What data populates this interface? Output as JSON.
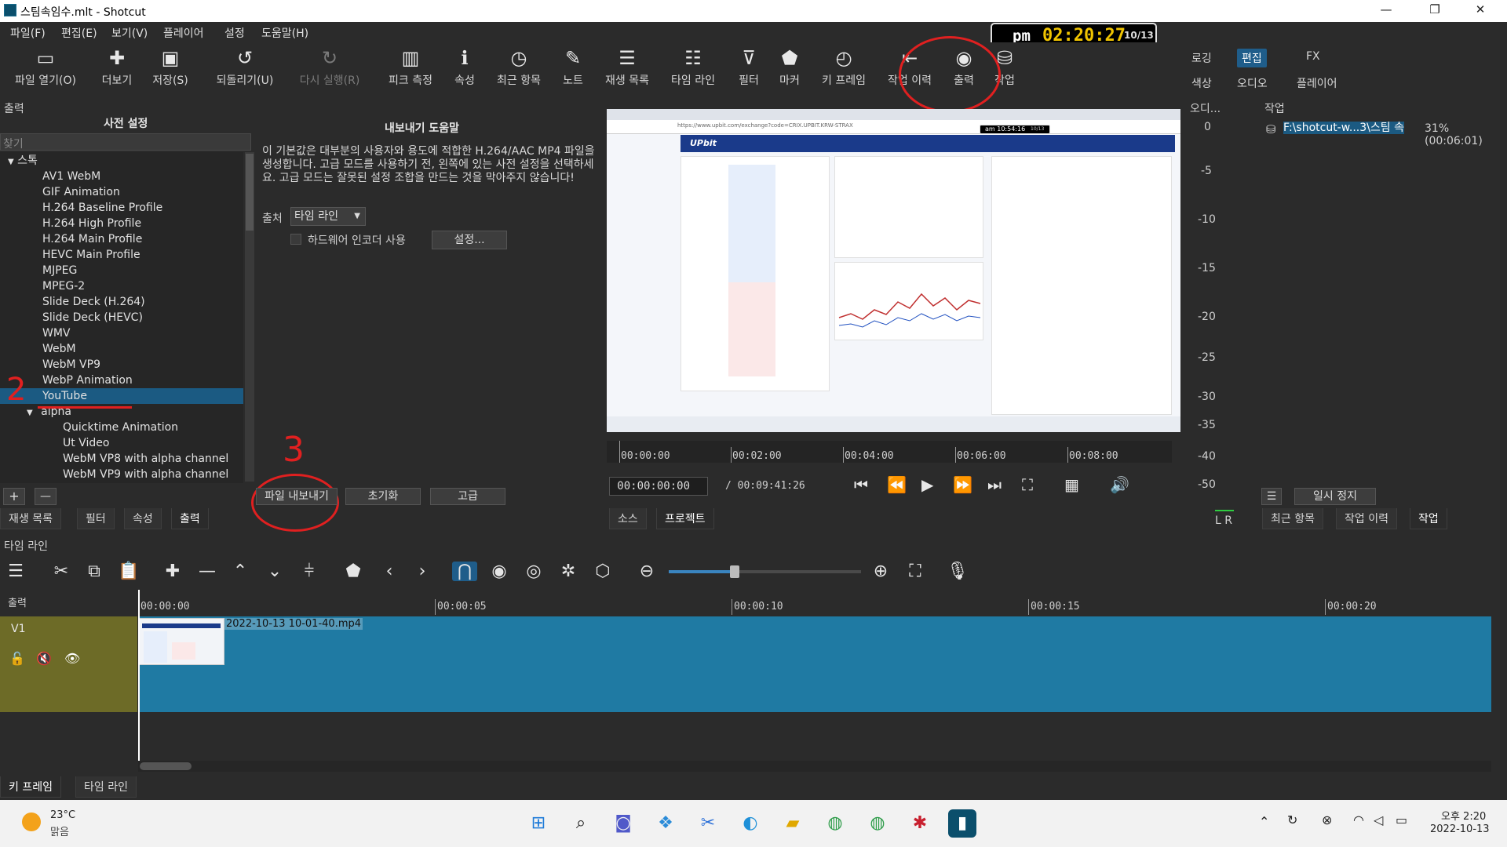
{
  "window": {
    "title": "스팀속임수.mlt - Shotcut",
    "min": "—",
    "max": "❐",
    "close": "✕"
  },
  "menu": [
    "파일(F)",
    "편집(E)",
    "보기(V)",
    "플레이어",
    "설정",
    "도움말(H)"
  ],
  "toolbar": [
    {
      "label": "파일 열기(O)",
      "icon": "folder-open-icon",
      "glyph": "▭"
    },
    {
      "label": "더보기",
      "icon": "more-icon",
      "glyph": "✚"
    },
    {
      "label": "저장(S)",
      "icon": "save-icon",
      "glyph": "▣"
    },
    {
      "label": "되돌리기(U)",
      "icon": "undo-icon",
      "glyph": "↺"
    },
    {
      "label": "다시 실행(R)",
      "icon": "redo-icon",
      "glyph": "↻"
    },
    {
      "label": "피크 측정",
      "icon": "peak-meter-icon",
      "glyph": "▥"
    },
    {
      "label": "속성",
      "icon": "properties-icon",
      "glyph": "ℹ"
    },
    {
      "label": "최근 항목",
      "icon": "recent-icon",
      "glyph": "◷"
    },
    {
      "label": "노트",
      "icon": "notes-icon",
      "glyph": "✎"
    },
    {
      "label": "재생 목록",
      "icon": "playlist-icon",
      "glyph": "☰"
    },
    {
      "label": "타임 라인",
      "icon": "timeline-icon",
      "glyph": "☷"
    },
    {
      "label": "필터",
      "icon": "filter-icon",
      "glyph": "⊽"
    },
    {
      "label": "마커",
      "icon": "marker-icon",
      "glyph": "⬟"
    },
    {
      "label": "키 프레임",
      "icon": "keyframe-icon",
      "glyph": "◴"
    },
    {
      "label": "작업 이력",
      "icon": "history-icon",
      "glyph": "⇤"
    },
    {
      "label": "출력",
      "icon": "export-icon",
      "glyph": "◉"
    },
    {
      "label": "작업",
      "icon": "jobs-icon",
      "glyph": "⛁"
    }
  ],
  "modes": {
    "logging": "로깅",
    "editing": "편집",
    "fx": "FX",
    "color": "색상",
    "audio": "오디오",
    "player": "플레이어"
  },
  "clock": {
    "ampm": "pm",
    "time": "02:20:27",
    "date": "10/13"
  },
  "export_panel": {
    "panel_title": "출력",
    "presets_header": "사전 설정",
    "search_placeholder": "찾기",
    "stock_group": "스톡",
    "presets": [
      "AV1 WebM",
      "GIF Animation",
      "H.264 Baseline Profile",
      "H.264 High Profile",
      "H.264 Main Profile",
      "HEVC Main Profile",
      "MJPEG",
      "MPEG-2",
      "Slide Deck (H.264)",
      "Slide Deck (HEVC)",
      "WMV",
      "WebM",
      "WebM VP9",
      "WebP Animation",
      "YouTube"
    ],
    "selected_preset": "YouTube",
    "alpha_group": "alpha",
    "alpha_presets": [
      "Quicktime Animation",
      "Ut Video",
      "WebM VP8 with alpha channel",
      "WebM VP9 with alpha channel"
    ],
    "help_title": "내보내기 도움말",
    "help_text": "이 기본값은 대부분의 사용자와 용도에 적합한 H.264/AAC MP4 파일을 생성합니다. 고급 모드를 사용하기 전, 왼쪽에 있는 사전 설정을 선택하세요. 고급 모드는 잘못된 설정 조합을 만드는 것을 막아주지 않습니다!",
    "source_label": "출처",
    "source_value": "타임 라인",
    "hw_encoder_label": "하드웨어 인코더 사용",
    "settings_button": "설정...",
    "export_file_button": "파일 내보내기",
    "reset_button": "초기화",
    "advanced_button": "고급",
    "add_button": "+",
    "remove_button": "—"
  },
  "left_tabs": [
    "재생 목록",
    "필터",
    "속성",
    "출력"
  ],
  "player": {
    "ruler": [
      "00:00:00",
      "00:02:00",
      "00:04:00",
      "00:06:00",
      "00:08:00"
    ],
    "position": "00:00:00:00",
    "duration": "/ 00:09:41:26",
    "tabs": [
      "소스",
      "프로젝트"
    ],
    "embedded": {
      "brand": "UPbit",
      "clock": "am 10:54:16",
      "clock_date": "10/13",
      "url": "https://www.upbit.com/exchange?code=CRIX.UPBIT.KRW-STRAX"
    }
  },
  "audio_meter": {
    "title": "오디...",
    "levels": [
      "0",
      "-5",
      "-10",
      "-15",
      "-20",
      "-25",
      "-30",
      "-35",
      "-40",
      "-50"
    ],
    "lr": "L R"
  },
  "jobs": {
    "title": "작업",
    "job_name": "F:\\shotcut-w...3\\스팀 속",
    "job_status": "31% (00:06:01)",
    "pause_button": "일시 정지",
    "tabs": [
      "최근 항목",
      "작업 이력",
      "작업"
    ]
  },
  "timeline": {
    "title": "타임 라인",
    "output_label": "출력",
    "track": "V1",
    "ruler": [
      "00:00:00",
      "00:00:05",
      "00:00:10",
      "00:00:15",
      "00:00:20"
    ],
    "clip_name": "2022-10-13 10-01-40.mp4",
    "bottom_tabs": [
      "키 프레임",
      "타임 라인"
    ]
  },
  "taskbar": {
    "weather_temp": "23°C",
    "weather_desc": "맑음",
    "time": "오후 2:20",
    "date": "2022-10-13"
  },
  "annotations": {
    "mark2": "2",
    "mark3": "3"
  }
}
